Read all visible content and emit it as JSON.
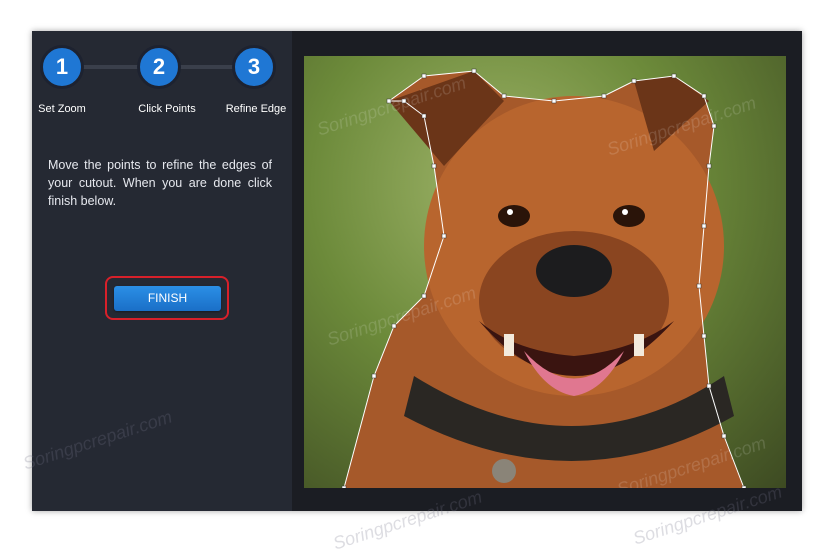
{
  "steps": [
    {
      "number": "1",
      "label": "Set Zoom"
    },
    {
      "number": "2",
      "label": "Click Points"
    },
    {
      "number": "3",
      "label": "Refine Edge"
    }
  ],
  "instructions": "Move the points to refine the edges of your cutout. When you are done click finish below.",
  "finish_button": {
    "label": "FINISH"
  },
  "watermark_text": "Soringpcrepair.com",
  "colors": {
    "accent": "#1f77d4",
    "highlight_border": "#d8202a",
    "sidebar_bg": "#252933",
    "stage_bg": "#1b1d23"
  }
}
